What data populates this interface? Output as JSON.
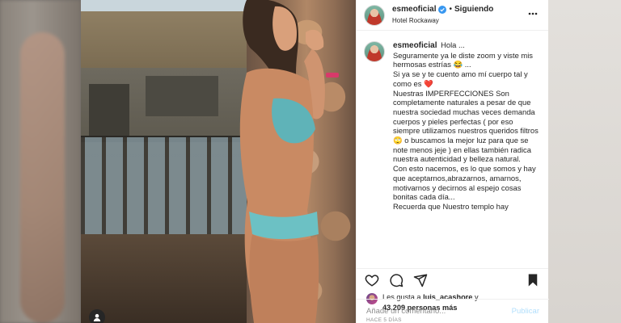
{
  "post": {
    "username": "esmeoficial",
    "follow_status": "Siguiendo",
    "separator": "•",
    "location": "Hotel Rockaway",
    "caption_lines": [
      "Hola ...",
      "Seguramente ya le diste zoom y viste mis hermosas estrías 😂 ...",
      "Si ya se y te cuento amo mí cuerpo tal y como es ❤️",
      "Nuestras IMPERFECCIONES Son completamente naturales a pesar de que nuestra sociedad muchas veces demanda cuerpos y pieles perfectas ( por eso siempre utilizamos nuestros queridos filtros 🙄 o buscamos la mejor luz para que se note menos jeje ) en ellas también radica nuestra autenticidad y belleza natural.",
      "Con esto nacemos, es lo que somos y hay que aceptarnos,abrazarnos, amarnos, motivarnos y decirnos al espejo cosas bonitas cada día...",
      "Recuerda que Nuestro templo hay"
    ],
    "likes_prefix": "Les gusta a",
    "likes_user": "luis_acashore",
    "likes_mid": "y",
    "likes_count": "43.209 personas más",
    "time_ago": "HACE 5 DÍAS",
    "comment_placeholder": "Añade un comentario...",
    "post_button": "Publicar"
  },
  "colors": {
    "verified": "#3897f0",
    "post_button_disabled": "#b2dffc",
    "heart": "#ed4956"
  },
  "icons": {
    "like": "heart-icon",
    "comment": "comment-icon",
    "share": "send-icon",
    "save": "bookmark-icon",
    "more": "more-horizontal-icon",
    "verified": "verified-badge-icon",
    "owner": "user-tag-icon"
  }
}
